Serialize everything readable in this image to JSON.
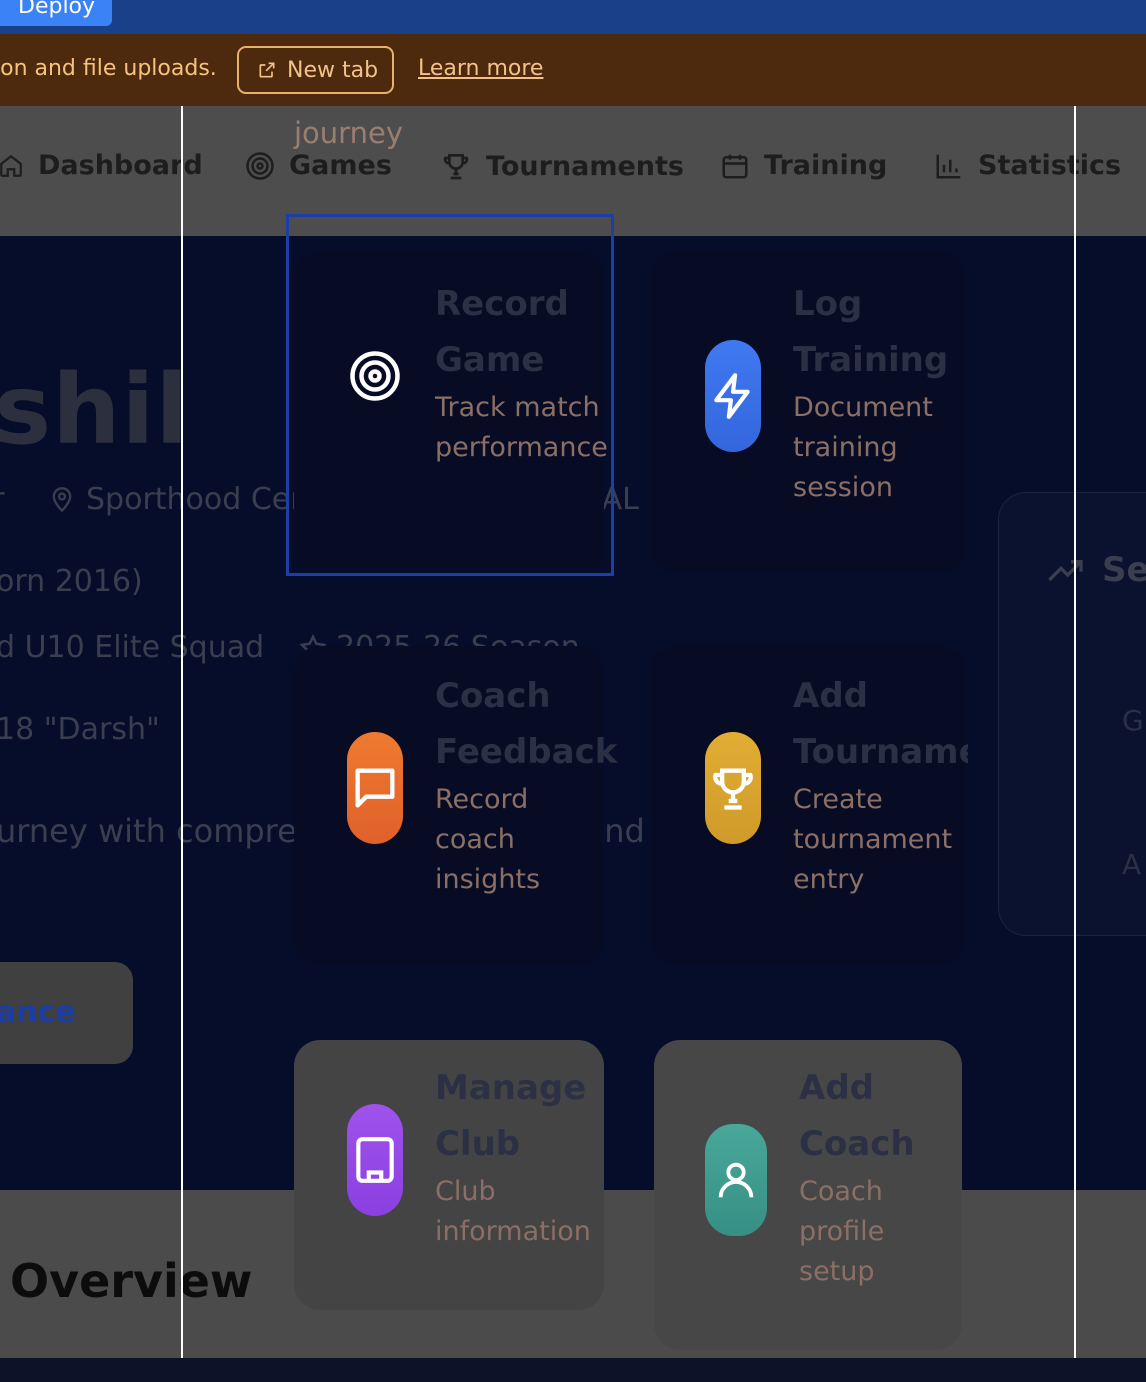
{
  "topbar": {
    "deploy_label": "Deploy"
  },
  "banner": {
    "message": "ion and file uploads.",
    "new_tab_label": "New tab",
    "learn_more_label": "Learn more"
  },
  "nav": {
    "journey_label": "journey",
    "items": [
      {
        "label": "Dashboard",
        "icon": "home-icon"
      },
      {
        "label": "Games",
        "icon": "target-icon"
      },
      {
        "label": "Tournaments",
        "icon": "trophy-icon"
      },
      {
        "label": "Training",
        "icon": "calendar-icon"
      },
      {
        "label": "Statistics",
        "icon": "bar-chart-icon"
      }
    ]
  },
  "hero": {
    "name_fragment": "shil",
    "role_fragment": "r",
    "location": "Sporthood Center of Excellence, HAL Sports Club",
    "born": "orn 2016)",
    "squad": "d U10 Elite Squad",
    "season": "2025-26 Season",
    "nickname": "18 \"Darsh\"",
    "tagline": "urney with comprehensive analytics and performance",
    "cta_label": "ance",
    "side_card_title": "Se",
    "side_card_line1": "G",
    "side_card_line2": "A"
  },
  "actions": [
    {
      "title_line1": "Record",
      "title_line2": "Game",
      "subtitle": [
        "Track match",
        "performance"
      ],
      "icon": "target-icon",
      "color": "#000000"
    },
    {
      "title_line1": "Log",
      "title_line2": "Training",
      "subtitle": [
        "Document",
        "training",
        "session"
      ],
      "icon": "lightning-icon",
      "color": "#3b6fe8"
    },
    {
      "title_line1": "Coach",
      "title_line2": "Feedback",
      "subtitle": [
        "Record",
        "coach",
        "insights"
      ],
      "icon": "chat-icon",
      "color": "#ea6d2e"
    },
    {
      "title_line1": "Add",
      "title_line2": "Tourname",
      "subtitle": [
        "Create",
        "tournament",
        "entry"
      ],
      "icon": "trophy-icon",
      "color": "#d9a530"
    },
    {
      "title_line1": "Manage",
      "title_line2": "Club",
      "subtitle": [
        "Club",
        "information"
      ],
      "icon": "building-icon",
      "color": "#9a4ae6"
    },
    {
      "title_line1": "Add",
      "title_line2": "Coach",
      "subtitle": [
        "Coach",
        "profile",
        "setup"
      ],
      "icon": "user-icon",
      "color": "#3d9a8e"
    }
  ],
  "overview_title": "Overview"
}
